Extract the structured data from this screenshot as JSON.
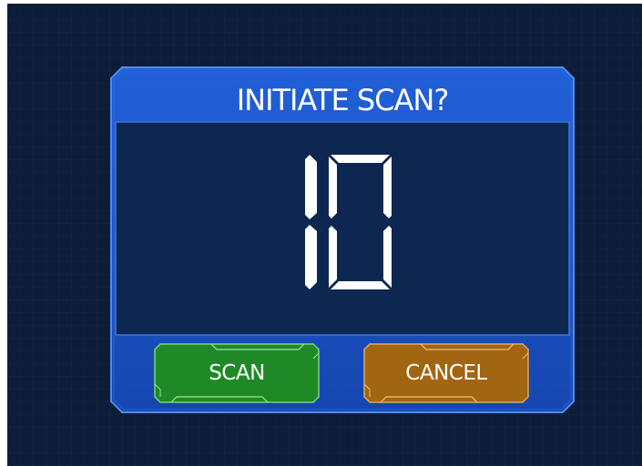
{
  "dialog": {
    "title": "INITIATE SCAN?",
    "countdown": "10"
  },
  "buttons": {
    "scan_label": "SCAN",
    "cancel_label": "CANCEL"
  },
  "colors": {
    "background": "#0d1c38",
    "dialog_frame": "#1a4fc0",
    "dialog_border": "#4a86ec",
    "dialog_inner": "#0d2750",
    "scan_button": "#1f8a25",
    "cancel_button": "#a26511"
  },
  "icons": [
    "seven-segment-digit-1",
    "seven-segment-digit-0"
  ]
}
